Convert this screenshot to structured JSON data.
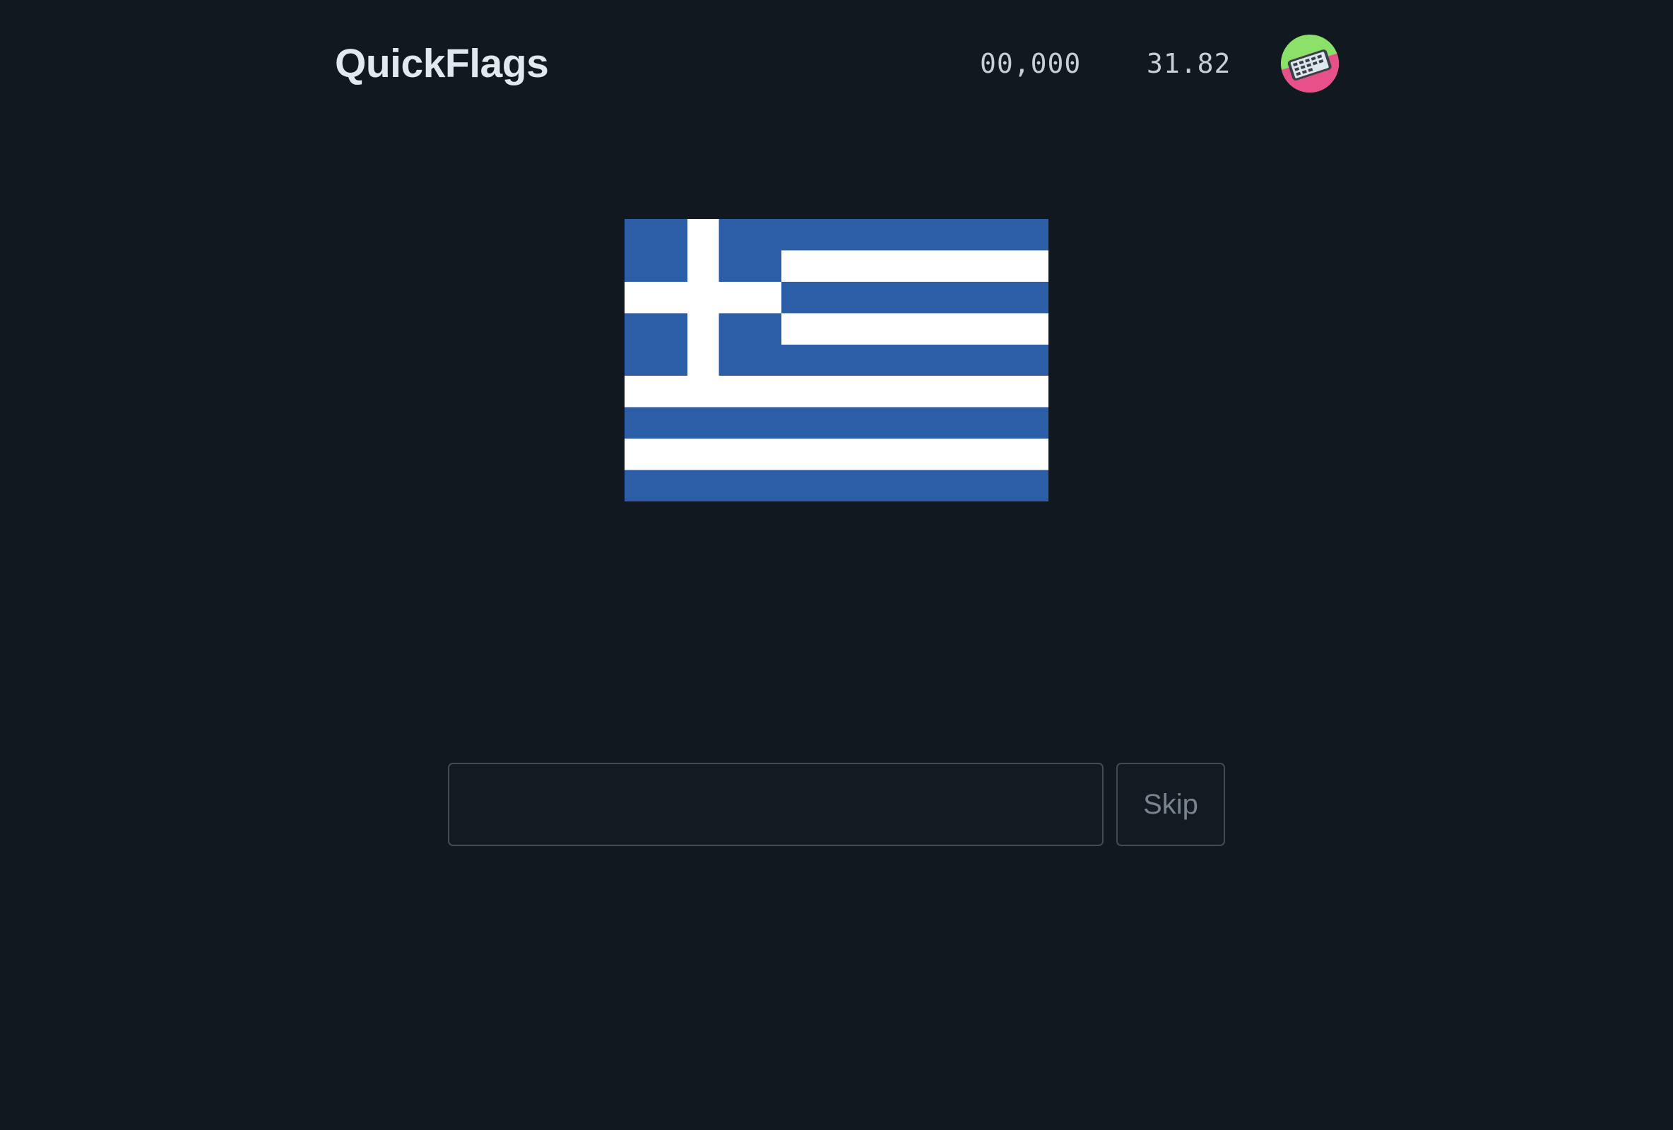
{
  "header": {
    "app_title": "QuickFlags",
    "score": "00,000",
    "timer": "31.82",
    "avatar_icon": "phone-icon"
  },
  "flag": {
    "icon": "flag-icon",
    "stripe_count": 9,
    "colors": {
      "blue": "#2c5ea8",
      "white": "#ffffff"
    }
  },
  "answer": {
    "value": "",
    "placeholder": "",
    "skip_label": "Skip"
  },
  "colors": {
    "background": "#121820",
    "title": "#e3e7ee",
    "muted": "#7b8390",
    "border": "#434a55"
  }
}
